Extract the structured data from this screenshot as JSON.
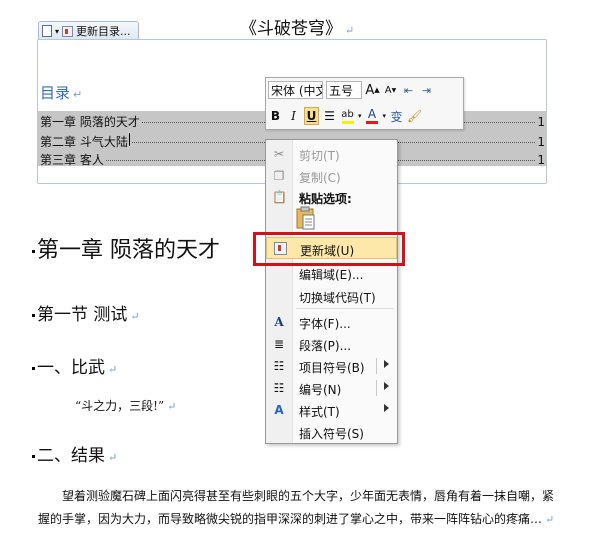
{
  "document": {
    "title": "《斗破苍穹》",
    "toc_field_toolbar": {
      "update_label": "更新目录..."
    },
    "toc": {
      "heading": "目录",
      "entries": [
        {
          "text": "第一章 陨落的天才",
          "page": "1"
        },
        {
          "text": "第二章 斗气大陆",
          "page": "1"
        },
        {
          "text": "第三章 客人",
          "page": "1"
        }
      ]
    },
    "headings": {
      "chapter1": "第一章  陨落的天才",
      "section1": "第一节   测试",
      "part1": "一、比武",
      "part2": "二、结果"
    },
    "quote": "“斗之力，三段!”",
    "body_paragraph": "望着测验魔石碑上面闪亮得甚至有些刺眼的五个大字，少年面无表情，唇角有着一抹自嘲，紧握的手掌，因为大力，而导致略微尖锐的指甲深深的刺进了掌心之中，带来一阵阵钻心的疼痛…",
    "paragraph_mark": "↵"
  },
  "mini_toolbar": {
    "font_name": "宋体 (中文",
    "font_size": "五号",
    "grow_font": "A",
    "shrink_font": "A",
    "bold": "B",
    "italic": "I",
    "underline": "U",
    "font_color_letter": "A",
    "phonetic": "变"
  },
  "context_menu": {
    "items": [
      {
        "label": "剪切(T)",
        "icon": "scissors-icon",
        "enabled": false
      },
      {
        "label": "复制(C)",
        "icon": "copy-icon",
        "enabled": false
      },
      {
        "label": "粘贴选项:",
        "icon": "paste-icon",
        "enabled": true,
        "bold": true
      },
      {
        "label": "更新域(U)",
        "icon": "update-field-icon",
        "enabled": true,
        "highlighted": true
      },
      {
        "label": "编辑域(E)...",
        "icon": "",
        "enabled": true
      },
      {
        "label": "切换域代码(T)",
        "icon": "",
        "enabled": true
      },
      {
        "label": "字体(F)...",
        "icon": "font-icon",
        "enabled": true
      },
      {
        "label": "段落(P)...",
        "icon": "paragraph-icon",
        "enabled": true
      },
      {
        "label": "项目符号(B)",
        "icon": "bullets-icon",
        "enabled": true,
        "submenu": true
      },
      {
        "label": "编号(N)",
        "icon": "numbering-icon",
        "enabled": true,
        "submenu": true
      },
      {
        "label": "样式(T)",
        "icon": "styles-icon",
        "enabled": true,
        "submenu": true
      },
      {
        "label": "插入符号(S)",
        "icon": "",
        "enabled": true
      }
    ]
  },
  "colors": {
    "highlight_frame": "#d3101c",
    "toc_heading": "#2f6db5",
    "menu_hover": "#fde8a9"
  }
}
